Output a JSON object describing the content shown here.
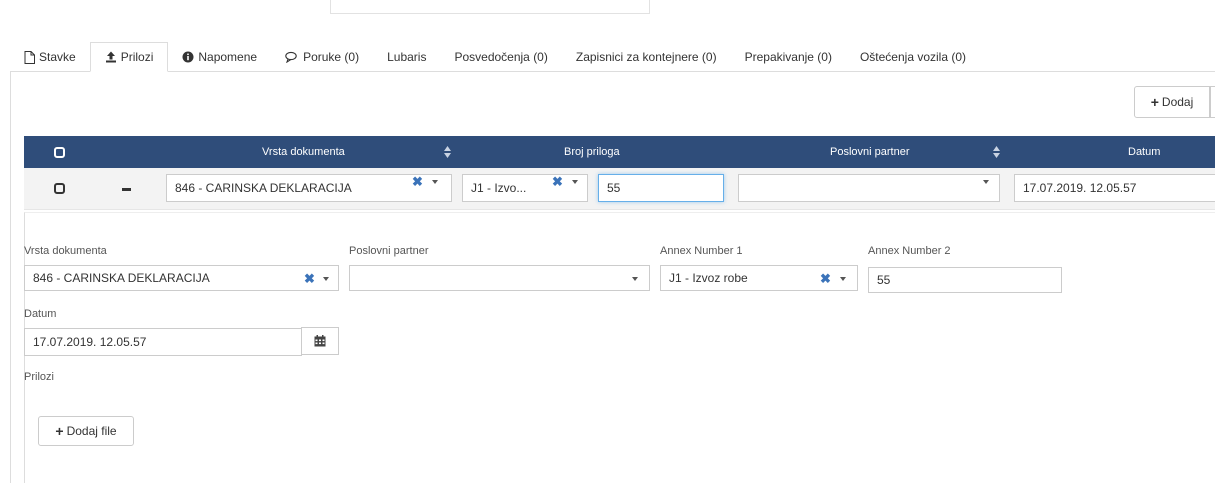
{
  "tabs": [
    {
      "label": "Stavke",
      "icon": "file-icon"
    },
    {
      "label": "Prilozi",
      "icon": "upload-icon"
    },
    {
      "label": "Napomene",
      "icon": "info-icon"
    },
    {
      "label": "Poruke (0)",
      "icon": "comments-icon"
    },
    {
      "label": "Lubaris",
      "icon": ""
    },
    {
      "label": "Posvedočenja (0)",
      "icon": ""
    },
    {
      "label": "Zapisnici za kontejnere (0)",
      "icon": ""
    },
    {
      "label": "Prepakivanje (0)",
      "icon": ""
    },
    {
      "label": "Oštećenja vozila (0)",
      "icon": ""
    }
  ],
  "active_tab": "Prilozi",
  "toolbar": {
    "add_label": "Dodaj"
  },
  "grid": {
    "headers": {
      "vrsta": "Vrsta dokumenta",
      "broj": "Broj priloga",
      "partner": "Poslovni partner",
      "datum": "Datum"
    },
    "row": {
      "vrsta": "846 - CARINSKA DEKLARACIJA",
      "annex1": "J1 - Izvo...",
      "broj": "55",
      "partner": "",
      "datum": "17.07.2019. 12.05.57"
    }
  },
  "form": {
    "vrsta_label": "Vrsta dokumenta",
    "vrsta_value": "846 - CARINSKA DEKLARACIJA",
    "partner_label": "Poslovni partner",
    "partner_value": "",
    "annex1_label": "Annex Number 1",
    "annex1_value": "J1 - Izvoz robe",
    "annex2_label": "Annex Number 2",
    "annex2_value": "55",
    "datum_label": "Datum",
    "datum_value": "17.07.2019. 12.05.57",
    "prilozi_label": "Prilozi",
    "add_file_label": "Dodaj file"
  },
  "colors": {
    "header_bg": "#2f4d7a",
    "clear_x": "#3b73b9",
    "focus": "#66afe9"
  }
}
